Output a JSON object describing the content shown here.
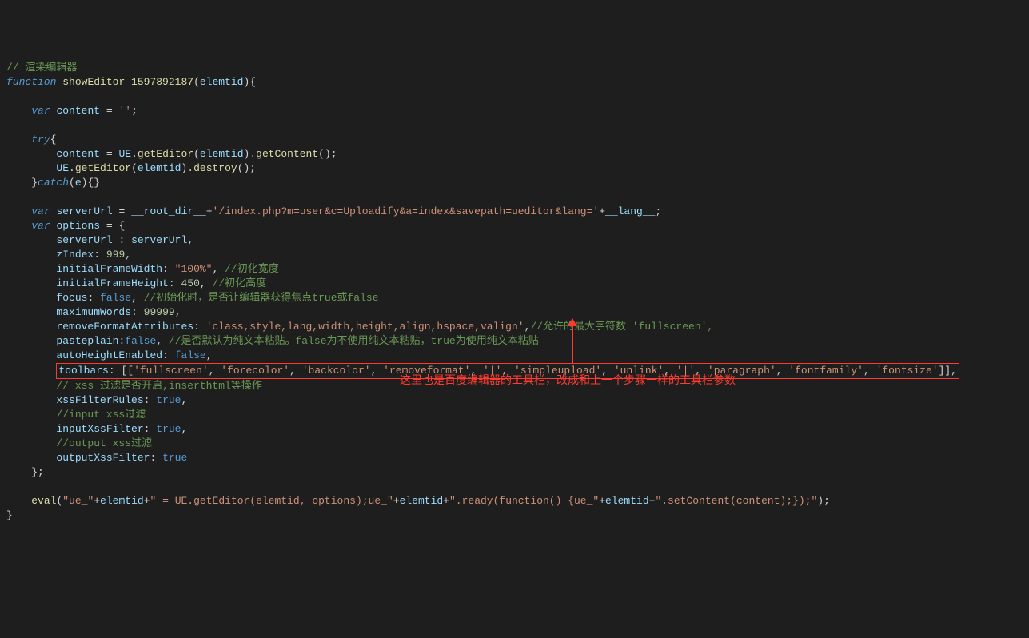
{
  "code": {
    "l1_comment": "// 渲染编辑器",
    "l2_kw_function": "function",
    "l2_fn": "showEditor_1597892187",
    "l2_param": "elemtid",
    "l4_kw_var": "var",
    "l4_content": "content",
    "l4_empty": "''",
    "l6_kw_try": "try",
    "l7_content": "content",
    "l7_ue": "UE",
    "l7_getEditor": "getEditor",
    "l7_elemtid": "elemtid",
    "l7_getContent": "getContent",
    "l8_ue": "UE",
    "l8_getEditor": "getEditor",
    "l8_elemtid": "elemtid",
    "l8_destroy": "destroy",
    "l9_kw_catch": "catch",
    "l9_e": "e",
    "l11_kw_var": "var",
    "l11_serverUrl": "serverUrl",
    "l11_rootdir": "__root_dir__",
    "l11_path": "'/index.php?m=user&c=Uploadify&a=index&savepath=ueditor&lang='",
    "l11_lang": "__lang__",
    "l12_kw_var": "var",
    "l12_options": "options",
    "l13_serverUrl_k": "serverUrl",
    "l13_serverUrl_v": "serverUrl",
    "l14_zIndex": "zIndex",
    "l14_999": "999",
    "l15_ifw": "initialFrameWidth",
    "l15_100": "\"100%\"",
    "l15_cm": "//初化宽度",
    "l16_ifh": "initialFrameHeight",
    "l16_450": "450",
    "l16_cm": "//初化高度",
    "l17_focus": "focus",
    "l17_false": "false",
    "l17_cm": "//初始化时，是否让编辑器获得焦点true或false",
    "l18_mw": "maximumWords",
    "l18_99999": "99999",
    "l19_rfa": "removeFormatAttributes",
    "l19_str": "'class,style,lang,width,height,align,hspace,valign'",
    "l19_cm": "//允许的最大字符数 'fullscreen',",
    "l20_pp": "pasteplain",
    "l20_false": "false",
    "l20_cm": "//是否默认为纯文本粘贴。false为不使用纯文本粘贴，true为使用纯文本粘贴",
    "l21_ahe": "autoHeightEnabled",
    "l21_false": "false",
    "l22_tb": "toolbars",
    "l22_fullscreen": "'fullscreen'",
    "l22_forecolor": "'forecolor'",
    "l22_backcolor": "'backcolor'",
    "l22_removeformat": "'removeformat'",
    "l22_pipe1": "'|'",
    "l22_simpleupload": "'simpleupload'",
    "l22_unlink": "'unlink'",
    "l22_pipe2": "'|'",
    "l22_paragraph": "'paragraph'",
    "l22_fontfamily": "'fontfamily'",
    "l22_fontsize": "'fontsize'",
    "l23_cm": "// xss 过滤是否开启,inserthtml等操作",
    "l24_xfr": "xssFilterRules",
    "l24_true": "true",
    "l25_cm": "//input xss过滤",
    "l26_ixf": "inputXssFilter",
    "l26_true": "true",
    "l27_cm": "//output xss过滤",
    "l28_oxf": "outputXssFilter",
    "l28_true": "true",
    "l31_eval": "eval",
    "l31_s1": "\"ue_\"",
    "l31_elemtid1": "elemtid",
    "l31_s2": "\" = UE.getEditor(elemtid, options);ue_\"",
    "l31_elemtid2": "elemtid",
    "l31_s3": "\".ready(function() {ue_\"",
    "l31_elemtid3": "elemtid",
    "l31_s4": "\".setContent(content);});\""
  },
  "annotation": "这里也是百度编辑器的工具栏，改成和上一个步骤一样的工具栏参数"
}
